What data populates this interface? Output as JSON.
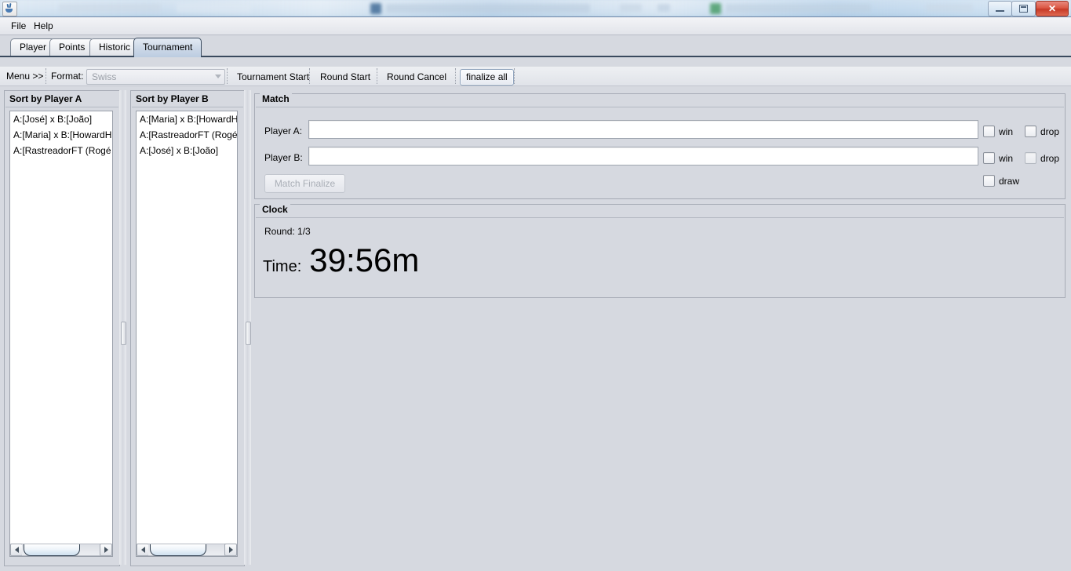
{
  "window": {
    "icon": "java-coffee-cup-icon",
    "buttons": {
      "minimize": "minimize-icon",
      "maximize": "maximize-icon",
      "close": "✕"
    }
  },
  "menubar": {
    "items": [
      {
        "label": "File"
      },
      {
        "label": "Help"
      }
    ]
  },
  "tabs": [
    {
      "label": "Player",
      "selected": false
    },
    {
      "label": "Points",
      "selected": false
    },
    {
      "label": "Historic",
      "selected": false
    },
    {
      "label": "Tournament",
      "selected": true
    }
  ],
  "toolbar": {
    "menu_label": "Menu >>",
    "format_label": "Format:",
    "format_value": "Swiss",
    "format_enabled": false,
    "dropdown_icon": "chevron-down-icon",
    "buttons": [
      {
        "label": "Tournament Start",
        "focused": false
      },
      {
        "label": "Round Start",
        "focused": false
      },
      {
        "label": "Round Cancel",
        "focused": false
      },
      {
        "label": "finalize all",
        "focused": true
      }
    ]
  },
  "panel_a": {
    "title": "Sort by Player A",
    "items": [
      "A:[José] x B:[João]",
      "A:[Maria] x B:[HowardHi",
      "A:[RastreadorFT (Rogé"
    ],
    "scrollbar": {
      "left_arrow": "arrow-left-icon",
      "right_arrow": "arrow-right-icon"
    }
  },
  "panel_b": {
    "title": "Sort by Player B",
    "items": [
      "A:[Maria] x B:[HowardHi",
      "A:[RastreadorFT (Rogé",
      "A:[José] x B:[João]"
    ],
    "scrollbar": {
      "left_arrow": "arrow-left-icon",
      "right_arrow": "arrow-right-icon"
    }
  },
  "match": {
    "title": "Match",
    "player_a_label": "Player A:",
    "player_a_value": "",
    "player_a_placeholder": "",
    "player_b_label": "Player B:",
    "player_b_value": "",
    "player_b_placeholder": "",
    "finalize_label": "Match Finalize",
    "finalize_enabled": false,
    "checkboxes": {
      "a_win": {
        "label": "win",
        "checked": false
      },
      "a_drop": {
        "label": "drop",
        "checked": false
      },
      "b_win": {
        "label": "win",
        "checked": false
      },
      "b_drop": {
        "label": "drop",
        "checked": false
      },
      "draw": {
        "label": "draw",
        "checked": false
      }
    }
  },
  "clock": {
    "title": "Clock",
    "round_label": "Round:  1/3",
    "time_label": "Time:",
    "time_value": "39:56m"
  },
  "colors": {
    "background": "#d6d9e0",
    "panel_border": "#a6abb5",
    "tab_selected": "#cdd9e8",
    "close_button": "#c63a27",
    "field_background": "#ffffff"
  }
}
